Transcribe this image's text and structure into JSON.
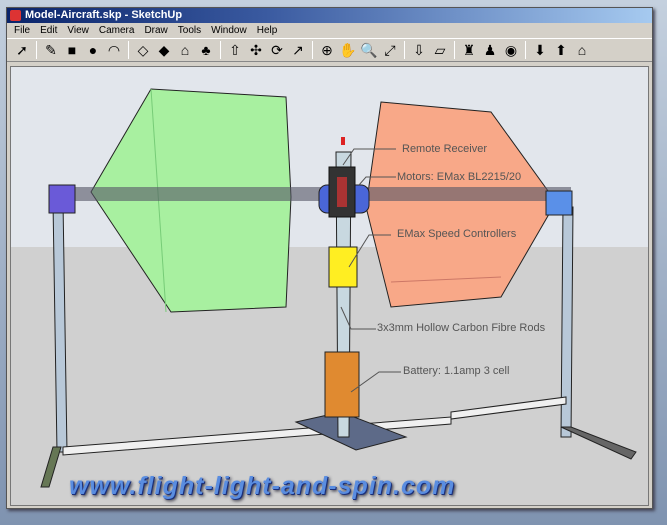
{
  "window": {
    "title": "Model-Aircraft.skp - SketchUp"
  },
  "menu": [
    "File",
    "Edit",
    "View",
    "Camera",
    "Draw",
    "Tools",
    "Window",
    "Help"
  ],
  "toolbar": [
    {
      "icon": "select-icon",
      "glyph": "➚"
    },
    {
      "sep": true
    },
    {
      "icon": "pencil-icon",
      "glyph": "✎"
    },
    {
      "icon": "rectangle-icon",
      "glyph": "■"
    },
    {
      "icon": "circle-icon",
      "glyph": "●"
    },
    {
      "icon": "arc-icon",
      "glyph": "◠"
    },
    {
      "sep": true
    },
    {
      "icon": "make-component-icon",
      "glyph": "◇"
    },
    {
      "icon": "eraser-icon",
      "glyph": "◆"
    },
    {
      "icon": "tape-measure-icon",
      "glyph": "⌂"
    },
    {
      "icon": "paint-bucket-icon",
      "glyph": "♣"
    },
    {
      "sep": true
    },
    {
      "icon": "push-pull-icon",
      "glyph": "⇧"
    },
    {
      "icon": "move-icon",
      "glyph": "✣"
    },
    {
      "icon": "rotate-icon",
      "glyph": "⟳"
    },
    {
      "icon": "offset-icon",
      "glyph": "↗"
    },
    {
      "sep": true
    },
    {
      "icon": "orbit-icon",
      "glyph": "⊕"
    },
    {
      "icon": "pan-icon",
      "glyph": "✋"
    },
    {
      "icon": "zoom-icon",
      "glyph": "🔍"
    },
    {
      "icon": "zoom-extents-icon",
      "glyph": "⤢"
    },
    {
      "sep": true
    },
    {
      "icon": "get-models-icon",
      "glyph": "⇩"
    },
    {
      "icon": "share-model-icon",
      "glyph": "▱"
    },
    {
      "sep": true
    },
    {
      "icon": "add-location-icon",
      "glyph": "♜"
    },
    {
      "icon": "toggle-terrain-icon",
      "glyph": "♟"
    },
    {
      "icon": "google-earth-icon",
      "glyph": "◉"
    },
    {
      "sep": true
    },
    {
      "icon": "get-components-icon",
      "glyph": "⬇"
    },
    {
      "icon": "share-component-icon",
      "glyph": "⬆"
    },
    {
      "icon": "warehouse-icon",
      "glyph": "⌂"
    }
  ],
  "labels": {
    "receiver": "Remote Receiver",
    "motors": "Motors: EMax BL2215/20",
    "controllers": "EMax Speed Controllers",
    "rods": "3x3mm Hollow Carbon Fibre Rods",
    "battery": "Battery: 1.1amp 3 cell"
  },
  "watermark": "www.flight-light-and-spin.com",
  "colors": {
    "left_wing": "#a8f0a0",
    "right_wing": "#f8a888",
    "motor_hub": "#4a66d8",
    "battery": "#e08a30",
    "controller": "#ffee22"
  }
}
